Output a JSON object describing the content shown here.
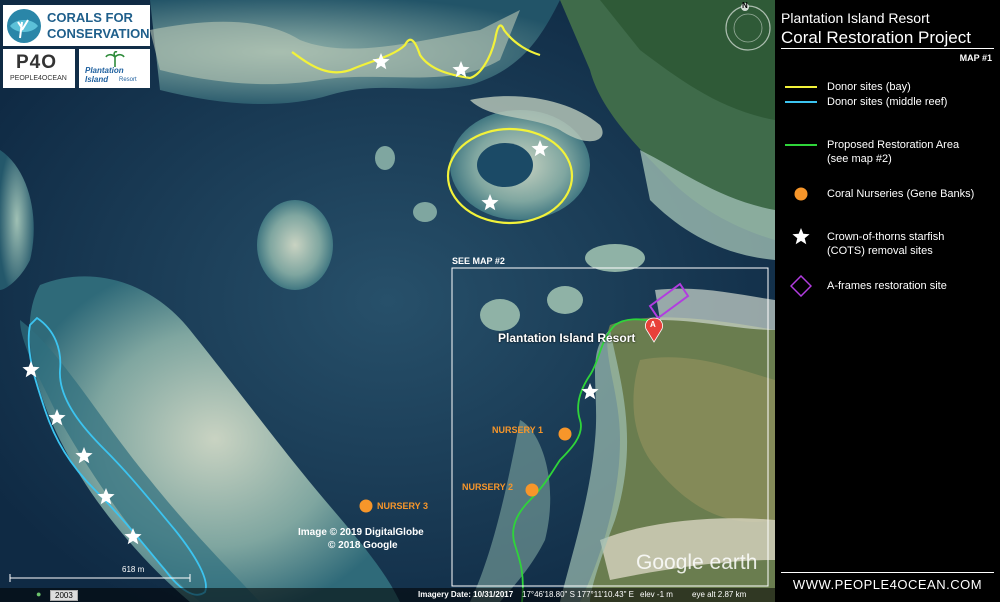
{
  "logos": {
    "corals_line1": "CORALS FOR",
    "corals_line2": "CONSERVATION",
    "p4o_mark": "P4O",
    "p4o_name": "PEOPLE4OCEAN",
    "resort_line1": "Plantation",
    "resort_line2": "Island",
    "resort_line3": "Resort"
  },
  "legend": {
    "title_line1": "Plantation Island Resort",
    "title_line2": "Coral Restoration Project",
    "map_number": "MAP #1",
    "items": [
      {
        "label": "Donor sites (bay)",
        "color": "#f2f23a"
      },
      {
        "label": "Donor sites (middle reef)",
        "color": "#3cc4f0"
      },
      {
        "label": "Proposed Restoration Area\n(see map #2)",
        "color": "#2fd43a"
      },
      {
        "label": "Coral Nurseries (Gene Banks)",
        "color": "#f7962a"
      },
      {
        "label": "Crown-of-thorns  starfish\n(COTS) removal sites",
        "color": "#ffffff"
      },
      {
        "label": "A-frames restoration site",
        "color": "#b23ce0"
      }
    ],
    "website": "WWW.PEOPLE4OCEAN.COM"
  },
  "map": {
    "see_map_label": "SEE MAP #2",
    "resort_label": "Plantation Island Resort",
    "marker_letter": "A",
    "nursery1": "NURSERY 1",
    "nursery2": "NURSERY 2",
    "nursery3": "NURSERY 3",
    "credit_line1": "Image © 2019 DigitalGlobe",
    "credit_line2": "© 2018 Google",
    "google_earth": "Google earth",
    "scale_label": "618 m",
    "compass_n": "N"
  },
  "status": {
    "year": "2003",
    "imagery_date": "Imagery Date: 10/31/2017",
    "coords": "17°46'18.80\" S  177°11'10.43\" E",
    "elev": "elev   -1 m",
    "eye_alt": "eye alt   2.87 km"
  }
}
